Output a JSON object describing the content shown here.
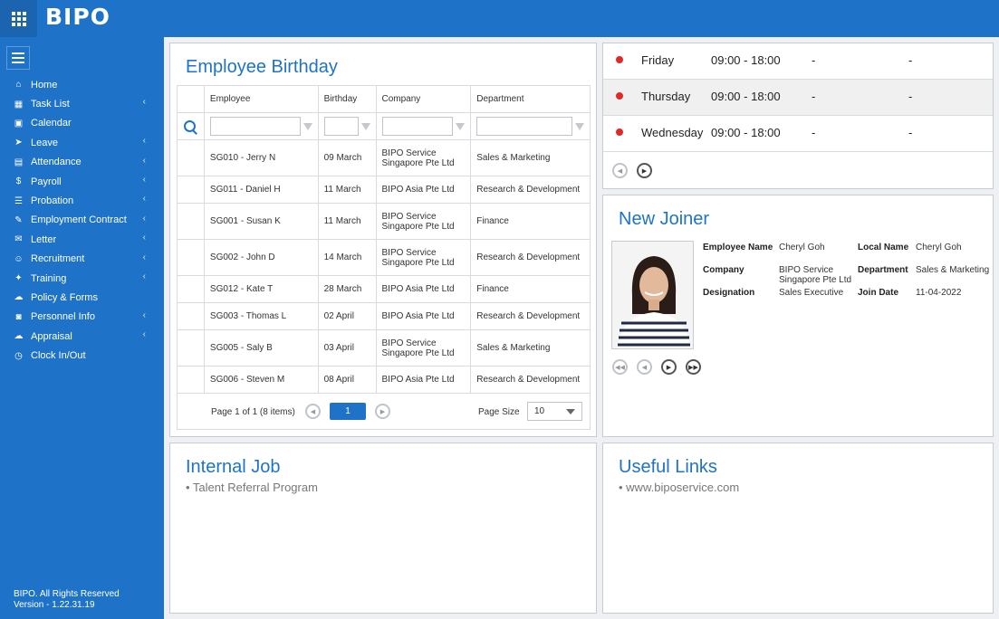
{
  "app": {
    "logo": "BIPO"
  },
  "sidebar": {
    "items": [
      {
        "label": "Home",
        "icon": "home-icon",
        "glyph": "⌂",
        "chevron": false
      },
      {
        "label": "Task List",
        "icon": "task-list-icon",
        "glyph": "▦",
        "chevron": true
      },
      {
        "label": "Calendar",
        "icon": "calendar-icon",
        "glyph": "▣",
        "chevron": false
      },
      {
        "label": "Leave",
        "icon": "leave-icon",
        "glyph": "➤",
        "chevron": true
      },
      {
        "label": "Attendance",
        "icon": "attendance-icon",
        "glyph": "▤",
        "chevron": true
      },
      {
        "label": "Payroll",
        "icon": "payroll-icon",
        "glyph": "$",
        "chevron": true
      },
      {
        "label": "Probation",
        "icon": "probation-icon",
        "glyph": "☰",
        "chevron": true
      },
      {
        "label": "Employment Contract",
        "icon": "contract-icon",
        "glyph": "✎",
        "chevron": true
      },
      {
        "label": "Letter",
        "icon": "letter-icon",
        "glyph": "✉",
        "chevron": true
      },
      {
        "label": "Recruitment",
        "icon": "recruitment-icon",
        "glyph": "☺",
        "chevron": true
      },
      {
        "label": "Training",
        "icon": "training-icon",
        "glyph": "✦",
        "chevron": true
      },
      {
        "label": "Policy & Forms",
        "icon": "policy-icon",
        "glyph": "☁",
        "chevron": false
      },
      {
        "label": "Personnel Info",
        "icon": "personnel-icon",
        "glyph": "◙",
        "chevron": true
      },
      {
        "label": "Appraisal",
        "icon": "appraisal-icon",
        "glyph": "☁",
        "chevron": true
      },
      {
        "label": "Clock In/Out",
        "icon": "clock-icon",
        "glyph": "◷",
        "chevron": false
      }
    ],
    "footer_line1": "BIPO. All Rights Reserved",
    "footer_line2": "Version - 1.22.31.19"
  },
  "birthday": {
    "title": "Employee Birthday",
    "columns": [
      "Employee",
      "Birthday",
      "Company",
      "Department"
    ],
    "rows": [
      [
        "SG010 - Jerry N",
        "09 March",
        "BIPO Service Singapore Pte Ltd",
        "Sales & Marketing"
      ],
      [
        "SG011 - Daniel H",
        "11 March",
        "BIPO Asia Pte Ltd",
        "Research & Development"
      ],
      [
        "SG001 - Susan K",
        "11 March",
        "BIPO Service Singapore Pte Ltd",
        "Finance"
      ],
      [
        "SG002 - John D",
        "14 March",
        "BIPO Service Singapore Pte Ltd",
        "Research & Development"
      ],
      [
        "SG012 - Kate T",
        "28 March",
        "BIPO Asia Pte Ltd",
        "Finance"
      ],
      [
        "SG003 - Thomas L",
        "02 April",
        "BIPO Asia Pte Ltd",
        "Research & Development"
      ],
      [
        "SG005 - Saly B",
        "03 April",
        "BIPO Service Singapore Pte Ltd",
        "Sales & Marketing"
      ],
      [
        "SG006 - Steven M",
        "08 April",
        "BIPO Asia Pte Ltd",
        "Research & Development"
      ]
    ],
    "pager": {
      "info": "Page 1 of 1 (8 items)",
      "current_page": "1",
      "page_size_label": "Page Size",
      "page_size": "10"
    }
  },
  "schedule": {
    "rows": [
      {
        "day": "Friday",
        "time": "09:00 - 18:00",
        "col1": "-",
        "col2": "-"
      },
      {
        "day": "Thursday",
        "time": "09:00 - 18:00",
        "col1": "-",
        "col2": "-"
      },
      {
        "day": "Wednesday",
        "time": "09:00 - 18:00",
        "col1": "-",
        "col2": "-"
      }
    ]
  },
  "new_joiner": {
    "title": "New Joiner",
    "labels": {
      "employee_name": "Employee Name",
      "local_name": "Local Name",
      "company": "Company",
      "department": "Department",
      "designation": "Designation",
      "join_date": "Join Date"
    },
    "values": {
      "employee_name": "Cheryl Goh",
      "local_name": "Cheryl Goh",
      "company": "BIPO Service Singapore Pte Ltd",
      "department": "Sales & Marketing",
      "designation": "Sales Executive",
      "join_date": "11-04-2022"
    }
  },
  "internal_job": {
    "title": "Internal Job",
    "items": [
      "• Talent Referral Program"
    ]
  },
  "useful_links": {
    "title": "Useful Links",
    "items": [
      "• www.biposervice.com"
    ]
  },
  "colors": {
    "accent": "#1e73c8",
    "dot": "#e02a2a"
  }
}
